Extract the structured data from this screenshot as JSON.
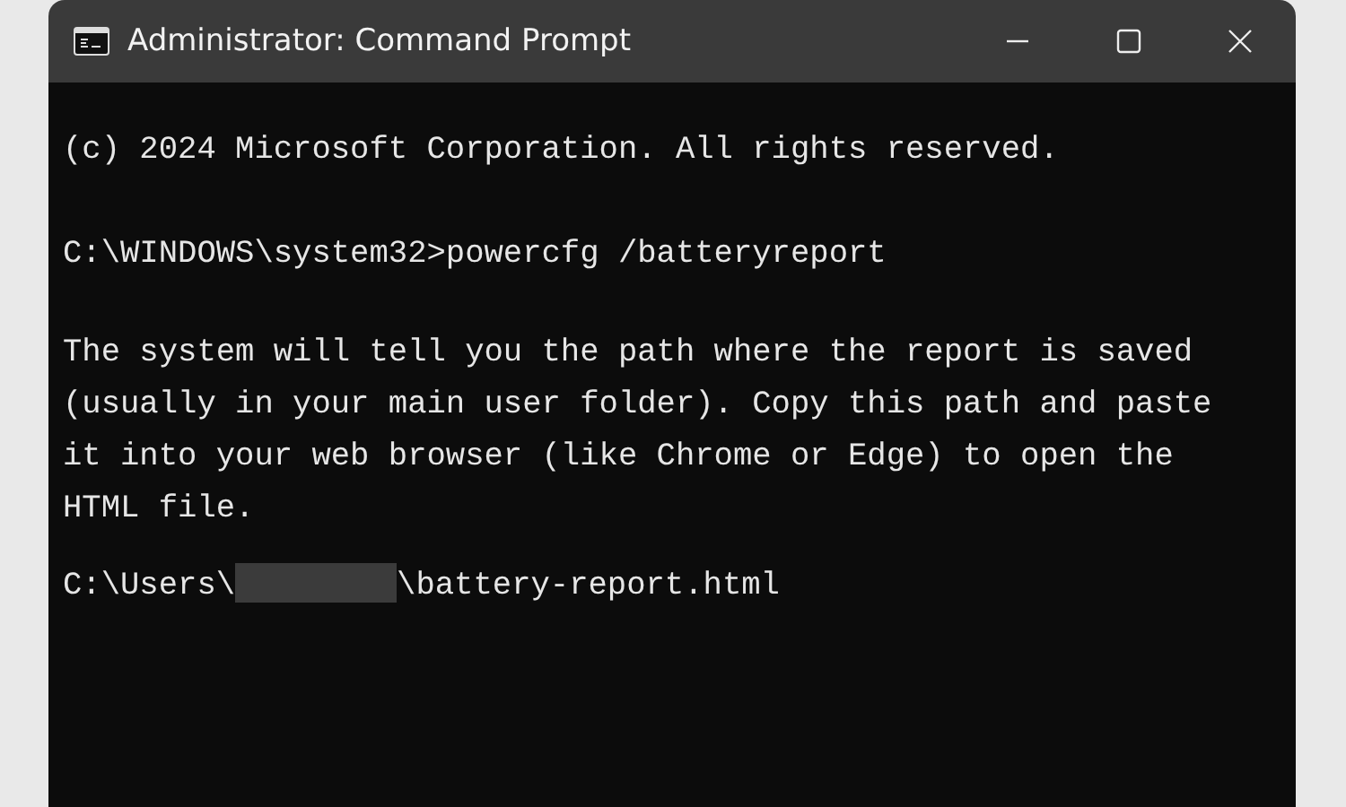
{
  "window": {
    "title": "Administrator: Command Prompt"
  },
  "console": {
    "lines": [
      {
        "kind": "text",
        "text": "(c) 2024 Microsoft Corporation. All rights reserved."
      },
      {
        "kind": "command",
        "prompt": "C:\\WINDOWS\\system32>",
        "command": "powercfg /batteryreport"
      },
      {
        "kind": "paragraph",
        "text": "The system will tell you the path where the report is saved (usually in your main user folder). Copy this path and paste it into your web browser (like Chrome or Edge) to open the HTML file."
      },
      {
        "kind": "path",
        "before": "C:\\Users\\",
        "redacted": true,
        "after": "\\battery-report.html"
      }
    ]
  }
}
